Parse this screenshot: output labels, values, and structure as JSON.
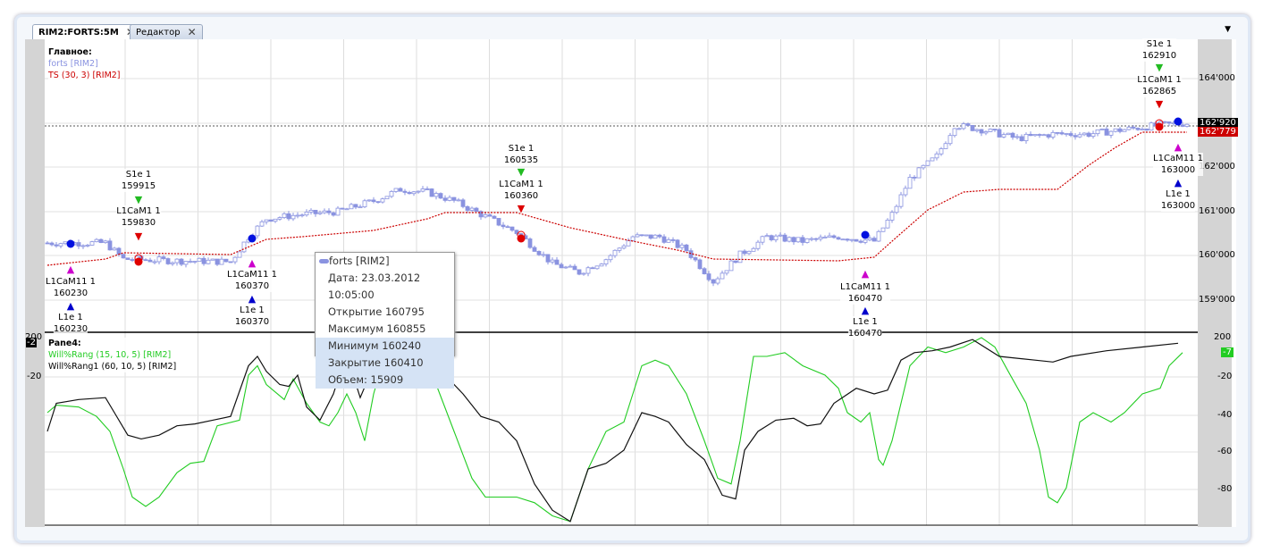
{
  "tabs": [
    {
      "label": "RIM2:FORTS:5M"
    },
    {
      "label": "Редактор"
    }
  ],
  "main_pane": {
    "title": "Главное:",
    "series": "forts [RIM2]",
    "indicator": "TS (30, 3) [RIM2]",
    "axis": [
      "164'000",
      "162'000",
      "161'000",
      "160'000",
      "159'000"
    ],
    "price_label": "162'920",
    "ts_label": "162'779"
  },
  "lower_pane": {
    "title": "Pane4:",
    "series1": "Will%Rang (15, 10, 5) [RIM2]",
    "series2": "Will%Rang1 (60, 10, 5) [RIM2]",
    "axis_right": [
      "200",
      "-20",
      "-40",
      "-60",
      "-80"
    ],
    "axis_left_top": "200",
    "left_badge": "-2",
    "right_badge": "-7"
  },
  "tooltip": {
    "title": "forts [RIM2]",
    "date": "Дата: 23.03.2012 10:05:00",
    "open": "Открытие 160795",
    "high": "Максимум 160855",
    "low": "Минимум 160240",
    "close": "Закрытие 160410",
    "volume": "Объем: 15909"
  },
  "markers": [
    {
      "text": "S1e 1",
      "value": "159915"
    },
    {
      "text": "L1CaM1 1",
      "value": "159830"
    },
    {
      "text": "L1CaM11 1",
      "value": "160230"
    },
    {
      "text": "L1e 1",
      "value": "160230"
    },
    {
      "text": "L1CaM11 1",
      "value": "160370"
    },
    {
      "text": "L1e 1",
      "value": "160370"
    },
    {
      "text": "S1e 1",
      "value": "160535"
    },
    {
      "text": "L1CaM1 1",
      "value": "160360"
    },
    {
      "text": "L1CaM11 1",
      "value": "160470"
    },
    {
      "text": "L1e 1",
      "value": "160470"
    },
    {
      "text": "S1e 1",
      "value": "162910"
    },
    {
      "text": "L1CaM1 1",
      "value": "162865"
    },
    {
      "text": "L1CaM11 1",
      "value": "163000"
    },
    {
      "text": "L1e 1",
      "value": "163000"
    }
  ],
  "colors": {
    "candle": "#8a93e0",
    "ts": "#cc0000",
    "willr15": "#22cc22",
    "willr60": "#111111",
    "buy": "#0000cc",
    "sell": "#22bb22",
    "exit": "#cc00cc"
  },
  "chart_data": {
    "type": "line",
    "price_keypoints": [
      [
        0,
        160283
      ],
      [
        13,
        160283
      ],
      [
        17,
        159919
      ],
      [
        29,
        159879
      ],
      [
        41,
        159859
      ],
      [
        45,
        160424
      ],
      [
        49,
        160828
      ],
      [
        57,
        160929
      ],
      [
        65,
        160990
      ],
      [
        73,
        161232
      ],
      [
        79,
        161495
      ],
      [
        85,
        161434
      ],
      [
        91,
        161232
      ],
      [
        97,
        160929
      ],
      [
        105,
        160525
      ],
      [
        113,
        159818
      ],
      [
        119,
        159616
      ],
      [
        125,
        159919
      ],
      [
        131,
        160424
      ],
      [
        137,
        160424
      ],
      [
        143,
        160121
      ],
      [
        149,
        159414
      ],
      [
        155,
        160020
      ],
      [
        161,
        160424
      ],
      [
        169,
        160323
      ],
      [
        177,
        160424
      ],
      [
        185,
        160323
      ],
      [
        189,
        160929
      ],
      [
        193,
        161737
      ],
      [
        199,
        162242
      ],
      [
        203,
        162949
      ],
      [
        209,
        162848
      ],
      [
        217,
        162646
      ],
      [
        225,
        162747
      ],
      [
        233,
        162747
      ],
      [
        241,
        162848
      ],
      [
        249,
        162949
      ],
      [
        255,
        162990
      ]
    ],
    "ts": [
      [
        0,
        159778
      ],
      [
        13,
        159919
      ],
      [
        17,
        160061
      ],
      [
        41,
        160020
      ],
      [
        49,
        160364
      ],
      [
        57,
        160424
      ],
      [
        73,
        160566
      ],
      [
        85,
        160828
      ],
      [
        89,
        160970
      ],
      [
        105,
        160970
      ],
      [
        117,
        160626
      ],
      [
        129,
        160364
      ],
      [
        141,
        160121
      ],
      [
        149,
        159919
      ],
      [
        177,
        159879
      ],
      [
        185,
        159960
      ],
      [
        189,
        160323
      ],
      [
        197,
        161030
      ],
      [
        205,
        161434
      ],
      [
        213,
        161495
      ],
      [
        226,
        161495
      ],
      [
        233,
        162040
      ],
      [
        239,
        162444
      ],
      [
        245,
        162788
      ],
      [
        255,
        162788
      ]
    ],
    "willr15": [
      [
        0,
        -40
      ],
      [
        2,
        -36
      ],
      [
        7,
        -37
      ],
      [
        11,
        -42
      ],
      [
        14,
        -50
      ],
      [
        17,
        -70
      ],
      [
        19,
        -85
      ],
      [
        22,
        -90
      ],
      [
        25,
        -85
      ],
      [
        29,
        -72
      ],
      [
        32,
        -67
      ],
      [
        35,
        -66
      ],
      [
        38,
        -47
      ],
      [
        43,
        -44
      ],
      [
        45,
        -20
      ],
      [
        47,
        -15
      ],
      [
        49,
        -25
      ],
      [
        53,
        -33
      ],
      [
        55,
        -22
      ],
      [
        58,
        -35
      ],
      [
        61,
        -45
      ],
      [
        63,
        -47
      ],
      [
        65,
        -40
      ],
      [
        67,
        -30
      ],
      [
        69,
        -40
      ],
      [
        71,
        -55
      ],
      [
        73,
        -30
      ],
      [
        76,
        -5
      ],
      [
        79,
        -1
      ],
      [
        83,
        -5
      ],
      [
        87,
        -25
      ],
      [
        91,
        -50
      ],
      [
        95,
        -75
      ],
      [
        98,
        -85
      ],
      [
        105,
        -85
      ],
      [
        109,
        -88
      ],
      [
        113,
        -95
      ],
      [
        117,
        -98
      ],
      [
        121,
        -70
      ],
      [
        125,
        -50
      ],
      [
        129,
        -45
      ],
      [
        133,
        -15
      ],
      [
        136,
        -12
      ],
      [
        139,
        -15
      ],
      [
        143,
        -30
      ],
      [
        147,
        -55
      ],
      [
        150,
        -75
      ],
      [
        153,
        -78
      ],
      [
        155,
        -55
      ],
      [
        158,
        -10
      ],
      [
        161,
        -10
      ],
      [
        165,
        -8
      ],
      [
        169,
        -15
      ],
      [
        174,
        -20
      ],
      [
        177,
        -27
      ],
      [
        179,
        -40
      ],
      [
        182,
        -45
      ],
      [
        184,
        -40
      ],
      [
        186,
        -65
      ],
      [
        187,
        -68
      ],
      [
        189,
        -55
      ],
      [
        193,
        -15
      ],
      [
        197,
        -5
      ],
      [
        201,
        -8
      ],
      [
        205,
        -5
      ],
      [
        209,
        0
      ],
      [
        212,
        -5
      ],
      [
        215,
        -18
      ],
      [
        219,
        -35
      ],
      [
        222,
        -60
      ],
      [
        224,
        -85
      ],
      [
        226,
        -88
      ],
      [
        228,
        -80
      ],
      [
        231,
        -45
      ],
      [
        234,
        -40
      ],
      [
        238,
        -45
      ],
      [
        241,
        -40
      ],
      [
        245,
        -30
      ],
      [
        249,
        -27
      ],
      [
        251,
        -15
      ],
      [
        254,
        -8
      ]
    ],
    "willr60": [
      [
        0,
        -50
      ],
      [
        2,
        -35
      ],
      [
        7,
        -33
      ],
      [
        13,
        -32
      ],
      [
        15,
        -40
      ],
      [
        18,
        -52
      ],
      [
        21,
        -54
      ],
      [
        25,
        -52
      ],
      [
        29,
        -47
      ],
      [
        33,
        -46
      ],
      [
        37,
        -44
      ],
      [
        41,
        -42
      ],
      [
        45,
        -15
      ],
      [
        47,
        -10
      ],
      [
        49,
        -18
      ],
      [
        52,
        -25
      ],
      [
        54,
        -26
      ],
      [
        56,
        -20
      ],
      [
        58,
        -37
      ],
      [
        61,
        -44
      ],
      [
        64,
        -30
      ],
      [
        66,
        -15
      ],
      [
        68,
        -17
      ],
      [
        70,
        -32
      ],
      [
        73,
        -15
      ],
      [
        77,
        -3
      ],
      [
        80,
        -1
      ],
      [
        85,
        -8
      ],
      [
        89,
        -20
      ],
      [
        93,
        -30
      ],
      [
        97,
        -42
      ],
      [
        101,
        -45
      ],
      [
        105,
        -55
      ],
      [
        109,
        -78
      ],
      [
        113,
        -92
      ],
      [
        117,
        -98
      ],
      [
        121,
        -70
      ],
      [
        125,
        -67
      ],
      [
        129,
        -60
      ],
      [
        133,
        -40
      ],
      [
        136,
        -42
      ],
      [
        139,
        -45
      ],
      [
        143,
        -57
      ],
      [
        147,
        -65
      ],
      [
        151,
        -84
      ],
      [
        154,
        -86
      ],
      [
        156,
        -60
      ],
      [
        159,
        -50
      ],
      [
        163,
        -44
      ],
      [
        167,
        -43
      ],
      [
        170,
        -47
      ],
      [
        173,
        -46
      ],
      [
        176,
        -35
      ],
      [
        181,
        -27
      ],
      [
        185,
        -30
      ],
      [
        188,
        -28
      ],
      [
        191,
        -12
      ],
      [
        194,
        -8
      ],
      [
        198,
        -7
      ],
      [
        202,
        -5
      ],
      [
        207,
        -1
      ],
      [
        213,
        -10
      ],
      [
        221,
        -12
      ],
      [
        225,
        -13
      ],
      [
        229,
        -10
      ],
      [
        237,
        -7
      ],
      [
        245,
        -5
      ],
      [
        253,
        -3
      ]
    ],
    "ylim_price": [
      158700,
      164700
    ],
    "ylim_willr": [
      -100,
      0
    ]
  }
}
